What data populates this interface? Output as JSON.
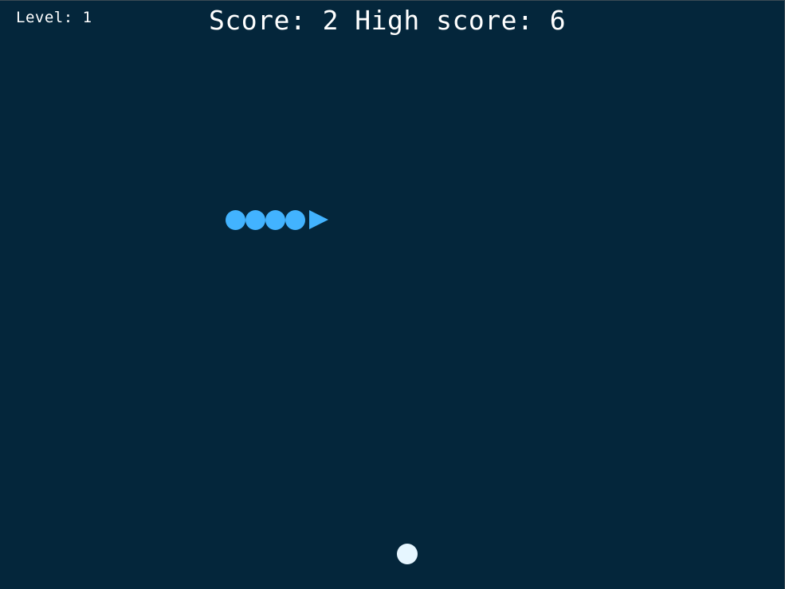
{
  "hud": {
    "level_label": "Level: 1",
    "score_label": "Score: 2 High score: 6"
  },
  "game": {
    "level": 1,
    "score": 2,
    "high_score": 6,
    "snake_body_segments": 4,
    "snake_direction": "right"
  },
  "colors": {
    "background": "#04263b",
    "snake": "#42b3ff",
    "food": "#e6f6ff",
    "text": "#ffffff"
  }
}
